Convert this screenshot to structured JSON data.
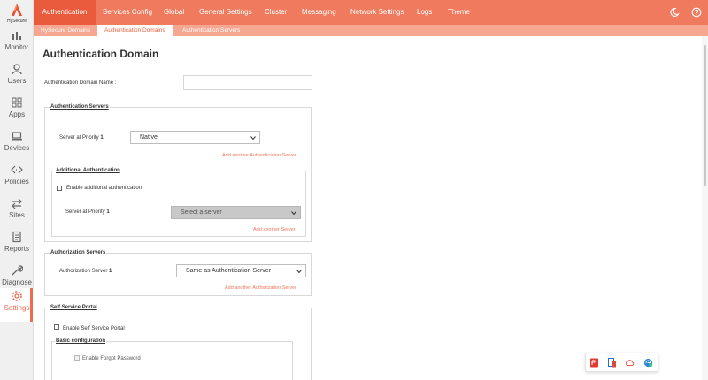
{
  "brand": {
    "name": "HySecure"
  },
  "sidebar": {
    "items": [
      {
        "label": "Monitor",
        "icon": "bar-chart-icon"
      },
      {
        "label": "Users",
        "icon": "user-icon"
      },
      {
        "label": "Apps",
        "icon": "apps-grid-icon"
      },
      {
        "label": "Devices",
        "icon": "laptop-icon"
      },
      {
        "label": "Policies",
        "icon": "code-arrows-icon"
      },
      {
        "label": "Sites",
        "icon": "swap-arrows-icon"
      },
      {
        "label": "Reports",
        "icon": "document-icon"
      },
      {
        "label": "Diagnose",
        "icon": "wrench-icon"
      },
      {
        "label": "Settings",
        "icon": "gear-icon"
      }
    ],
    "active": "Settings"
  },
  "topnav": {
    "tabs": [
      "Authentication",
      "Services Config",
      "Global",
      "General Settings",
      "Cluster",
      "Messaging",
      "Network Settings",
      "Logs",
      "Theme"
    ],
    "active": "Authentication",
    "right_icons": [
      "moon-icon",
      "help-icon"
    ]
  },
  "subnav": {
    "tabs": [
      "HySecure Domains",
      "Authentication Domains",
      "Authentication Servers"
    ],
    "active": "Authentication Domains"
  },
  "page": {
    "title": "Authentication Domain",
    "domain_name_label": "Authentication Domain Name :",
    "domain_name_value": ""
  },
  "auth_servers": {
    "legend": "Authentication Servers",
    "priority_label": "Server at Priority",
    "priority_num": "1",
    "selected": "Native",
    "add_link": "Add another Authentication Server"
  },
  "additional_auth": {
    "legend": "Additional Authentication",
    "enable_label": "Enable additional authentication",
    "enabled": false,
    "priority_label": "Server at Priority",
    "priority_num": "1",
    "selected": "Select a server",
    "add_link": "Add another Server"
  },
  "authorization": {
    "legend": "Authorization Servers",
    "server_label": "Authorization Server",
    "server_num": "1",
    "selected": "Same as Authentication Server",
    "add_link": "Add another Authorization Server"
  },
  "self_service": {
    "legend": "Self Service Portal",
    "enable_label": "Enable Self Service Portal",
    "enabled": false,
    "basic_legend": "Basic configuration",
    "forgot_label": "Enable Forgot Password",
    "forgot_enabled": false
  },
  "tray": {
    "icons": [
      "pdf-icon",
      "document-phone-icon",
      "cloud-icon",
      "edge-browser-icon"
    ]
  },
  "colors": {
    "accent": "#f07a5e",
    "accent_dark": "#ea5b3e",
    "sub_bar": "#f6a791",
    "link": "#f0755a"
  }
}
